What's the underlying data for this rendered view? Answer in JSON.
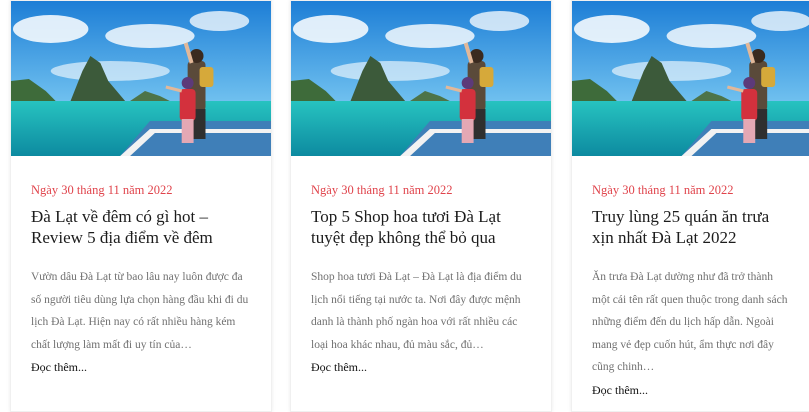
{
  "posts": [
    {
      "image": "travel-couple-boat-island-photo",
      "date": "Ngày 30 tháng 11 năm 2022",
      "title": "Đà Lạt về đêm có gì hot – Review 5 địa điểm về đêm",
      "excerpt": "Vườn dâu Đà Lạt từ bao lâu nay luôn được đa số người tiêu dùng lựa chọn hàng đầu khi đi du lịch Đà Lạt. Hiện nay có rất nhiều hàng kém chất lượng làm mất đi uy tín của…",
      "read_more": "Đọc thêm..."
    },
    {
      "image": "travel-couple-boat-island-photo",
      "date": "Ngày 30 tháng 11 năm 2022",
      "title": "Top 5 Shop hoa tươi Đà Lạt tuyệt đẹp không thể bỏ qua",
      "excerpt": "Shop hoa tươi Đà Lạt – Đà Lạt là địa điểm du lịch nổi tiếng tại nước ta. Nơi đây được mệnh danh là thành phố ngàn hoa với rất nhiều các loại hoa khác nhau, đủ màu sắc, đủ…",
      "read_more": "Đọc thêm..."
    },
    {
      "image": "travel-couple-boat-island-photo",
      "date": "Ngày 30 tháng 11 năm 2022",
      "title": "Truy lùng 25 quán ăn trưa xịn nhất Đà Lạt 2022",
      "excerpt": "Ăn trưa Đà Lạt dường như đã trở thành một cái tên rất quen thuộc trong danh sách những điểm đến du lịch hấp dẫn. Ngoài mang vẻ đẹp cuốn hút, ẩm thực nơi đây cũng chinh…",
      "read_more": "Đọc thêm..."
    }
  ],
  "colors": {
    "date": "#e0434b",
    "title": "#1c1c1c",
    "excerpt": "#707070",
    "sky": "#2f8fd8",
    "sea": "#1fb5b0"
  }
}
